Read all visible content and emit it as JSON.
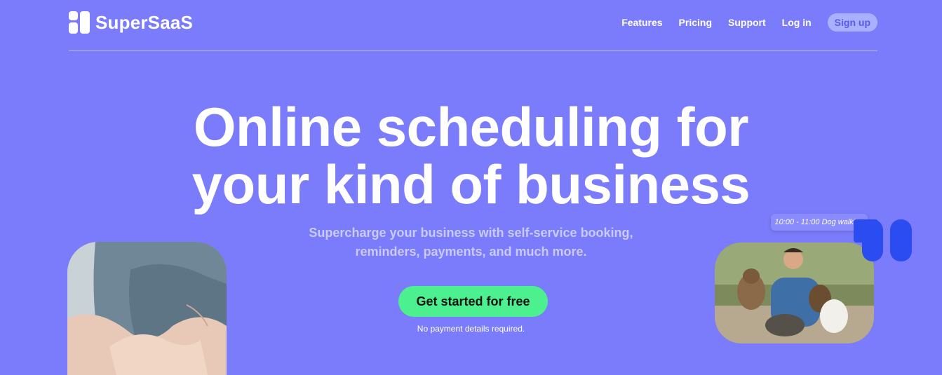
{
  "brand": {
    "name": "SuperSaaS"
  },
  "nav": {
    "features": "Features",
    "pricing": "Pricing",
    "support": "Support",
    "login": "Log in",
    "signup": "Sign up"
  },
  "hero": {
    "title_line1": "Online scheduling for",
    "title_line2": "your kind of business",
    "subtitle_line1": "Supercharge your business with self-service booking,",
    "subtitle_line2": "reminders, payments, and much more.",
    "cta": "Get started for free",
    "note": "No payment details required."
  },
  "tag": {
    "text": "10:00 - 11:00 Dog walking"
  },
  "colors": {
    "background": "#7b7cfb",
    "cta": "#4cf08f",
    "accent_blue": "#2b4cf0"
  }
}
